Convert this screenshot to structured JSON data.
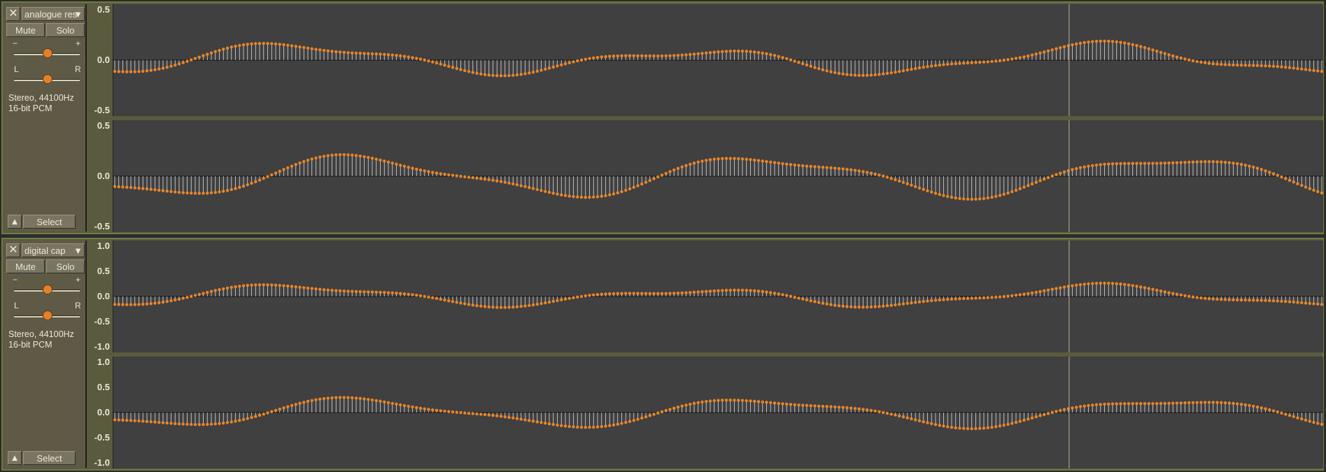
{
  "colors": {
    "waveform": "#e8862a",
    "background": "#404040",
    "panel": "#5e5a46",
    "cursor": "#b8b39a"
  },
  "tracks": [
    {
      "name": "analogue res",
      "close_icon": "✕",
      "dropdown_icon": "▼",
      "mute_label": "Mute",
      "solo_label": "Solo",
      "gain_minus": "−",
      "gain_plus": "+",
      "pan_left": "L",
      "pan_right": "R",
      "gain_level": 0.5,
      "pan_level": 0.5,
      "format_line1": "Stereo, 44100Hz",
      "format_line2": "16-bit PCM",
      "collapse_icon": "▲",
      "select_label": "Select",
      "channels": [
        {
          "ticks": [
            "0.5",
            "0.0",
            "-0.5"
          ],
          "range": [
            -0.5,
            0.5
          ]
        },
        {
          "ticks": [
            "0.5",
            "0.0",
            "-0.5"
          ],
          "range": [
            -0.5,
            0.5
          ]
        }
      ]
    },
    {
      "name": "digital cap",
      "close_icon": "✕",
      "dropdown_icon": "▼",
      "mute_label": "Mute",
      "solo_label": "Solo",
      "gain_minus": "−",
      "gain_plus": "+",
      "pan_left": "L",
      "pan_right": "R",
      "gain_level": 0.5,
      "pan_level": 0.5,
      "format_line1": "Stereo, 44100Hz",
      "format_line2": "16-bit PCM",
      "collapse_icon": "▲",
      "select_label": "Select",
      "channels": [
        {
          "ticks": [
            "1.0",
            "0.5",
            "0.0",
            "-0.5",
            "-1.0"
          ],
          "range": [
            -1.0,
            1.0
          ]
        },
        {
          "ticks": [
            "1.0",
            "0.5",
            "0.0",
            "-0.5",
            "-1.0"
          ],
          "range": [
            -1.0,
            1.0
          ]
        }
      ]
    }
  ],
  "cursor_position": 0.79
}
